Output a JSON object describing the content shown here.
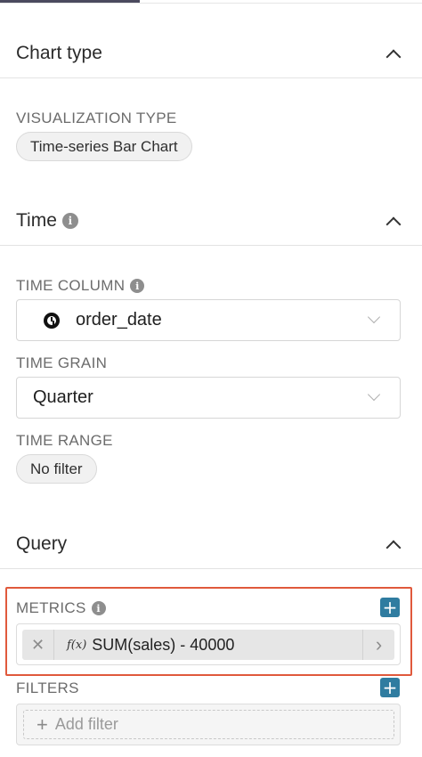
{
  "sections": {
    "chart_type": {
      "title": "Chart type"
    },
    "time": {
      "title": "Time"
    },
    "query": {
      "title": "Query"
    }
  },
  "chart_type": {
    "viz_label": "VISUALIZATION TYPE",
    "viz_value": "Time-series Bar Chart"
  },
  "time": {
    "column_label": "TIME COLUMN",
    "column_value": "order_date",
    "grain_label": "TIME GRAIN",
    "grain_value": "Quarter",
    "range_label": "TIME RANGE",
    "range_value": "No filter"
  },
  "query": {
    "metrics_label": "METRICS",
    "metric_fx": "f(x)",
    "metric_value": "SUM(sales) - 40000",
    "filters_label": "FILTERS",
    "filter_placeholder": "Add filter"
  },
  "icons": {
    "info": "info-icon",
    "clock": "clock-icon",
    "plus": "+",
    "remove": "✕",
    "arrow": "›"
  },
  "colors": {
    "accent": "#2f7ca0",
    "highlight": "#e0593c"
  }
}
